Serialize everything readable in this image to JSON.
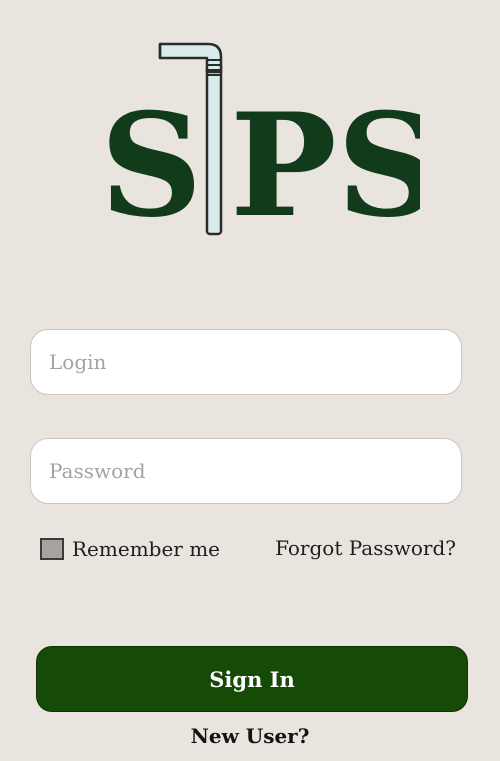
{
  "logo": {
    "text_left": "S",
    "text_right": "PS",
    "straw_icon": "straw-icon"
  },
  "form": {
    "login_placeholder": "Login",
    "password_placeholder": "Password",
    "remember_label": "Remember me",
    "forgot_label": "Forgot Password?",
    "signin_label": "Sign In",
    "newuser_label": "New User?"
  },
  "colors": {
    "background": "#e9e4dd",
    "brand_green": "#123b1b",
    "button_green": "#164a07",
    "straw": "#d9ecec"
  }
}
